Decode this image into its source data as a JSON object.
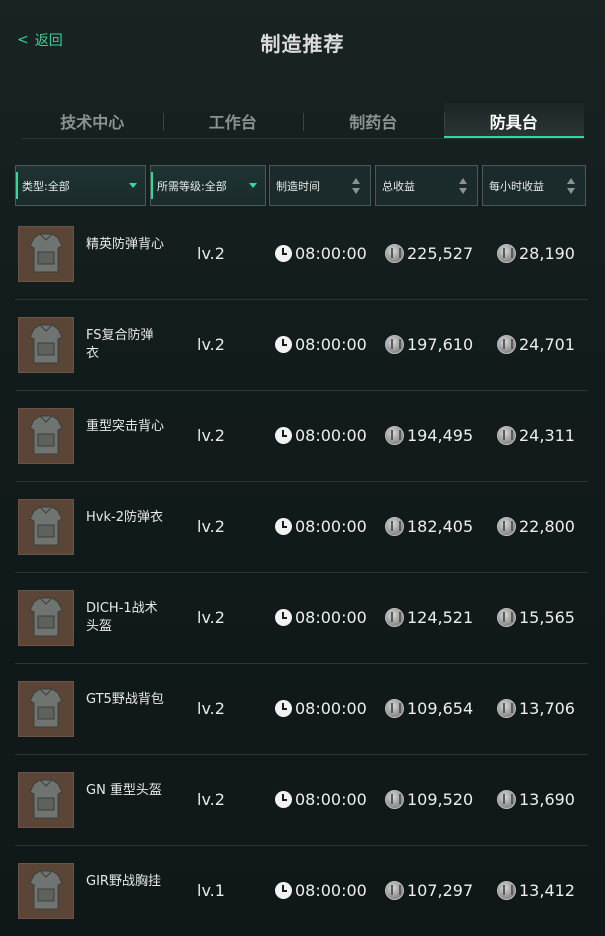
{
  "header": {
    "back_label": "返回",
    "title": "制造推荐"
  },
  "tabs": [
    {
      "label": "技术中心",
      "active": false
    },
    {
      "label": "工作台",
      "active": false
    },
    {
      "label": "制药台",
      "active": false
    },
    {
      "label": "防具台",
      "active": true
    }
  ],
  "filters": {
    "type": "类型:全部",
    "level": "所需等级:全部",
    "time": "制造时间",
    "total": "总收益",
    "hourly": "每小时收益"
  },
  "items": [
    {
      "name": "精英防弹背心",
      "level": "lv.2",
      "time": "08:00:00",
      "total": "225,527",
      "hourly": "28,190"
    },
    {
      "name": "FS复合防弹衣",
      "level": "lv.2",
      "time": "08:00:00",
      "total": "197,610",
      "hourly": "24,701"
    },
    {
      "name": "重型突击背心",
      "level": "lv.2",
      "time": "08:00:00",
      "total": "194,495",
      "hourly": "24,311"
    },
    {
      "name": "Hvk-2防弹衣",
      "level": "lv.2",
      "time": "08:00:00",
      "total": "182,405",
      "hourly": "22,800"
    },
    {
      "name": "DICH-1战术头盔",
      "level": "lv.2",
      "time": "08:00:00",
      "total": "124,521",
      "hourly": "15,565"
    },
    {
      "name": "GT5野战背包",
      "level": "lv.2",
      "time": "08:00:00",
      "total": "109,654",
      "hourly": "13,706"
    },
    {
      "name": "GN 重型头盔",
      "level": "lv.2",
      "time": "08:00:00",
      "total": "109,520",
      "hourly": "13,690"
    },
    {
      "name": "GIR野战胸挂",
      "level": "lv.1",
      "time": "08:00:00",
      "total": "107,297",
      "hourly": "13,412"
    }
  ],
  "icons": {
    "clock": "clock-icon",
    "coin": "coin-icon"
  },
  "colors": {
    "accent": "#2fd99a",
    "back_link": "#3fcf9a",
    "background": "#121b1c"
  }
}
